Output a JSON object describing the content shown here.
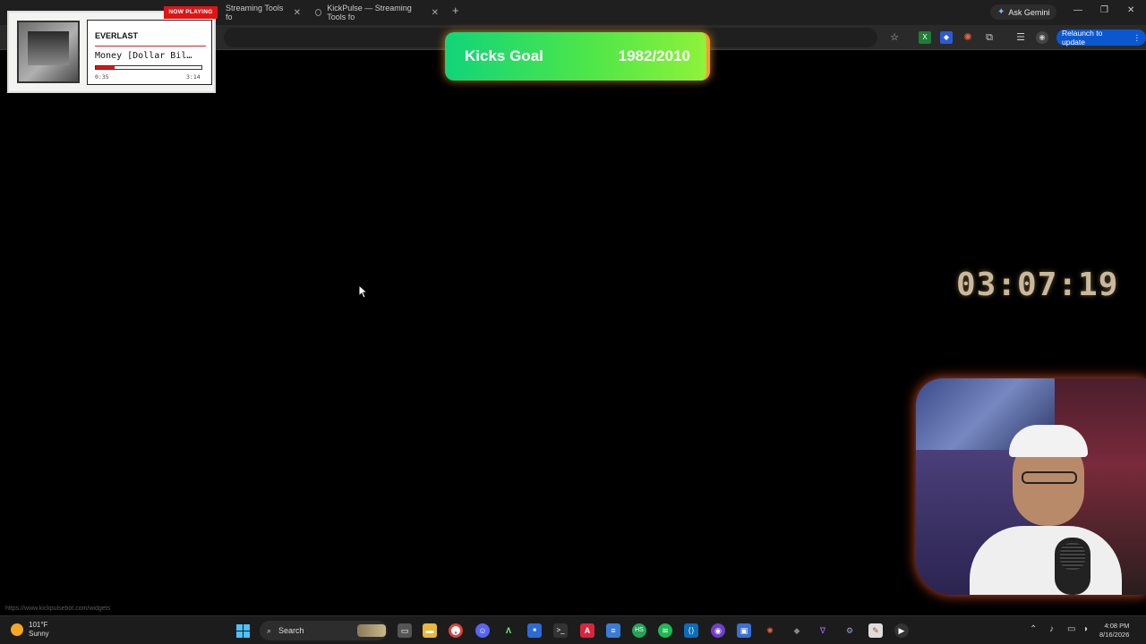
{
  "browser": {
    "tabs": [
      {
        "label": "Streaming Tools fo"
      },
      {
        "label": "KickPulse — Streaming Tools fo"
      }
    ],
    "new_tab_icon": "plus-icon",
    "ask_gemini_label": "Ask Gemini",
    "relaunch_label": "Relaunch to update",
    "status_url": "https://www.kickpulsebot.com/widgets"
  },
  "now_playing": {
    "badge": "NOW PLAYING",
    "artist": "EVERLAST",
    "song": "Money [Dollar Bil…",
    "elapsed": "0:35",
    "duration": "3:14",
    "progress_fraction": 0.18,
    "accent_color": "#e01414"
  },
  "goal": {
    "label": "Kicks Goal",
    "value": "1982/2010",
    "gradient_start": "#11d47a",
    "gradient_end": "#8ef23a",
    "glow_color": "#ff9a2a"
  },
  "timer": {
    "value": "03:07:19"
  },
  "taskbar": {
    "weather_temp": "101°F",
    "weather_condition": "Sunny",
    "search_label": "Search",
    "time": "4:08 PM",
    "date": "8/16/2026"
  }
}
